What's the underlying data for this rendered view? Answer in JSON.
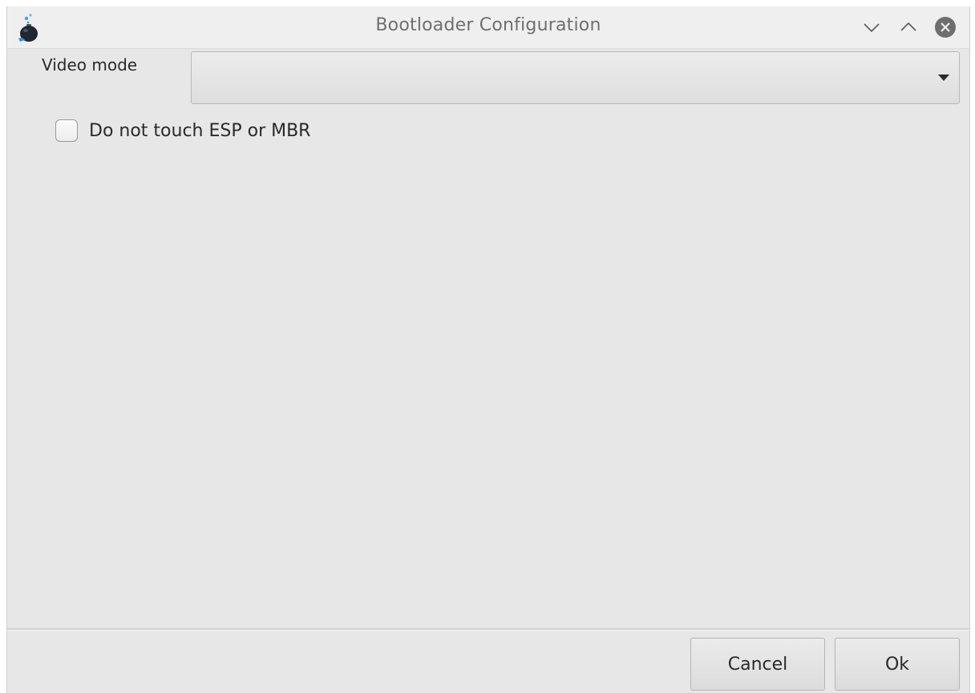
{
  "window": {
    "title": "Bootloader Configuration",
    "app_icon": "bootloader-app-icon",
    "controls": {
      "minimize_icon": "chevron-down-icon",
      "maximize_icon": "chevron-up-icon",
      "close_icon": "close-icon"
    }
  },
  "form": {
    "video_mode": {
      "label": "Video mode",
      "value": ""
    },
    "do_not_touch_esp_mbr": {
      "label": "Do not touch ESP or MBR",
      "checked": false
    }
  },
  "footer": {
    "cancel_label": "Cancel",
    "ok_label": "Ok"
  },
  "colors": {
    "background": "#e7e7e7",
    "titlebar": "#efefef",
    "close_button": "#6e6e6e",
    "text": "#2a2a2a"
  }
}
